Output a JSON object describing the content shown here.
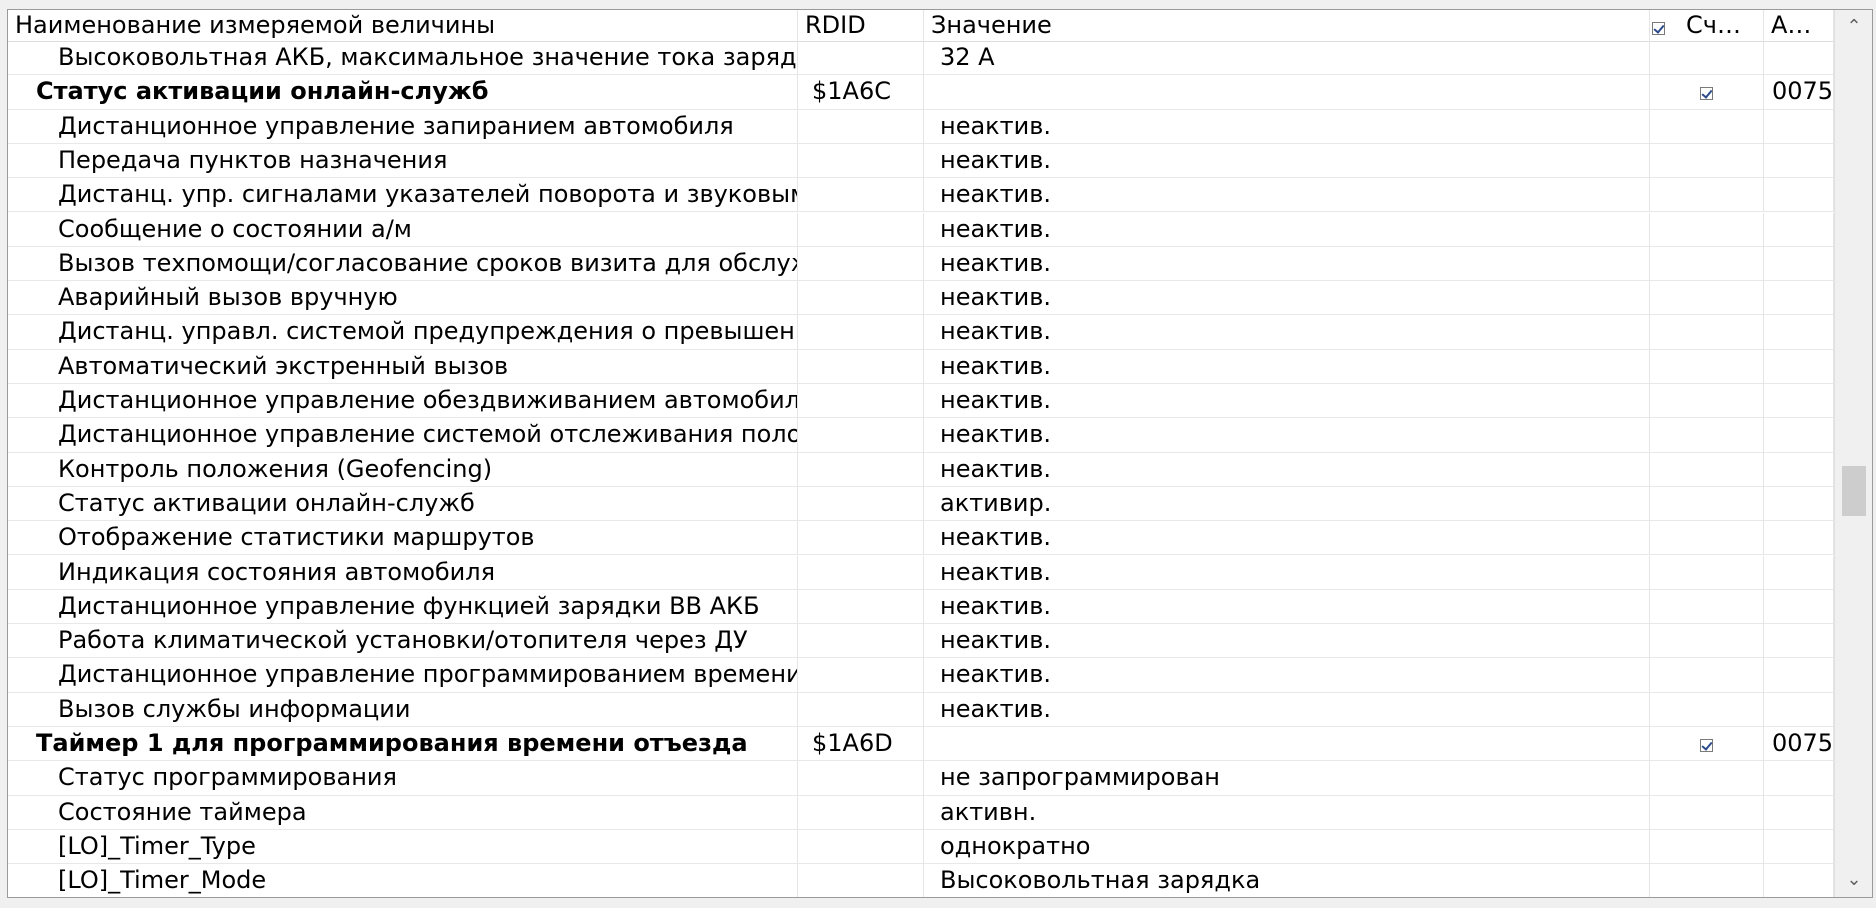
{
  "columns": {
    "name": "Наименование измеряемой величины",
    "rdid": "RDID",
    "value": "Значение",
    "read": "Сч…",
    "addr": "А…"
  },
  "rows": [
    {
      "name": "Высоковольтная АКБ, максимальное значение тока заряда",
      "rdid": "",
      "value": "32 A",
      "checked": false,
      "addr": "",
      "group": false
    },
    {
      "name": "Статус активации онлайн-служб",
      "rdid": "$1A6C",
      "value": "",
      "checked": true,
      "addr": "0075",
      "group": true
    },
    {
      "name": "Дистанционное управление запиранием автомобиля",
      "rdid": "",
      "value": "неактив.",
      "checked": false,
      "addr": "",
      "group": false
    },
    {
      "name": "Передача пунктов назначения",
      "rdid": "",
      "value": "неактив.",
      "checked": false,
      "addr": "",
      "group": false
    },
    {
      "name": "Дистанц. упр. сигналами указателей поворота и звуковым",
      "rdid": "",
      "value": "неактив.",
      "checked": false,
      "addr": "",
      "group": false
    },
    {
      "name": "Сообщение о состоянии а/м",
      "rdid": "",
      "value": "неактив.",
      "checked": false,
      "addr": "",
      "group": false
    },
    {
      "name": "Вызов техпомощи/согласование сроков визита для обслуж",
      "rdid": "",
      "value": "неактив.",
      "checked": false,
      "addr": "",
      "group": false
    },
    {
      "name": "Аварийный вызов вручную",
      "rdid": "",
      "value": "неактив.",
      "checked": false,
      "addr": "",
      "group": false
    },
    {
      "name": "Дистанц. управл. системой предупреждения о превышени",
      "rdid": "",
      "value": "неактив.",
      "checked": false,
      "addr": "",
      "group": false
    },
    {
      "name": "Автоматический экстренный вызов",
      "rdid": "",
      "value": "неактив.",
      "checked": false,
      "addr": "",
      "group": false
    },
    {
      "name": "Дистанционное управление обездвиживанием автомобиля",
      "rdid": "",
      "value": "неактив.",
      "checked": false,
      "addr": "",
      "group": false
    },
    {
      "name": "Дистанционное управление системой отслеживания полож",
      "rdid": "",
      "value": "неактив.",
      "checked": false,
      "addr": "",
      "group": false
    },
    {
      "name": "Контроль положения (Geofencing)",
      "rdid": "",
      "value": "неактив.",
      "checked": false,
      "addr": "",
      "group": false
    },
    {
      "name": "Статус активации онлайн-служб",
      "rdid": "",
      "value": "активир.",
      "checked": false,
      "addr": "",
      "group": false
    },
    {
      "name": "Отображение статистики маршрутов",
      "rdid": "",
      "value": "неактив.",
      "checked": false,
      "addr": "",
      "group": false
    },
    {
      "name": "Индикация состояния автомобиля",
      "rdid": "",
      "value": "неактив.",
      "checked": false,
      "addr": "",
      "group": false
    },
    {
      "name": "Дистанционное управление функцией зарядки ВВ АКБ",
      "rdid": "",
      "value": "неактив.",
      "checked": false,
      "addr": "",
      "group": false
    },
    {
      "name": "Работа климатической установки/отопителя через ДУ",
      "rdid": "",
      "value": "неактив.",
      "checked": false,
      "addr": "",
      "group": false
    },
    {
      "name": "Дистанционное управление программированием времени",
      "rdid": "",
      "value": "неактив.",
      "checked": false,
      "addr": "",
      "group": false
    },
    {
      "name": "Вызов службы информации",
      "rdid": "",
      "value": "неактив.",
      "checked": false,
      "addr": "",
      "group": false
    },
    {
      "name": "Таймер 1 для программирования времени отъезда",
      "rdid": "$1A6D",
      "value": "",
      "checked": true,
      "addr": "0075",
      "group": true
    },
    {
      "name": "Статус программирования",
      "rdid": "",
      "value": "не запрограммирован",
      "checked": false,
      "addr": "",
      "group": false
    },
    {
      "name": "Состояние таймера",
      "rdid": "",
      "value": "активн.",
      "checked": false,
      "addr": "",
      "group": false
    },
    {
      "name": "[LO]_Timer_Type",
      "rdid": "",
      "value": "однократно",
      "checked": false,
      "addr": "",
      "group": false
    },
    {
      "name": "[LO]_Timer_Mode",
      "rdid": "",
      "value": "Высоковольтная зарядка",
      "checked": false,
      "addr": "",
      "group": false
    }
  ],
  "scrollbar": {
    "up_icon": "chevron-up-icon",
    "down_icon": "chevron-down-icon",
    "position_fraction": 0.52
  }
}
